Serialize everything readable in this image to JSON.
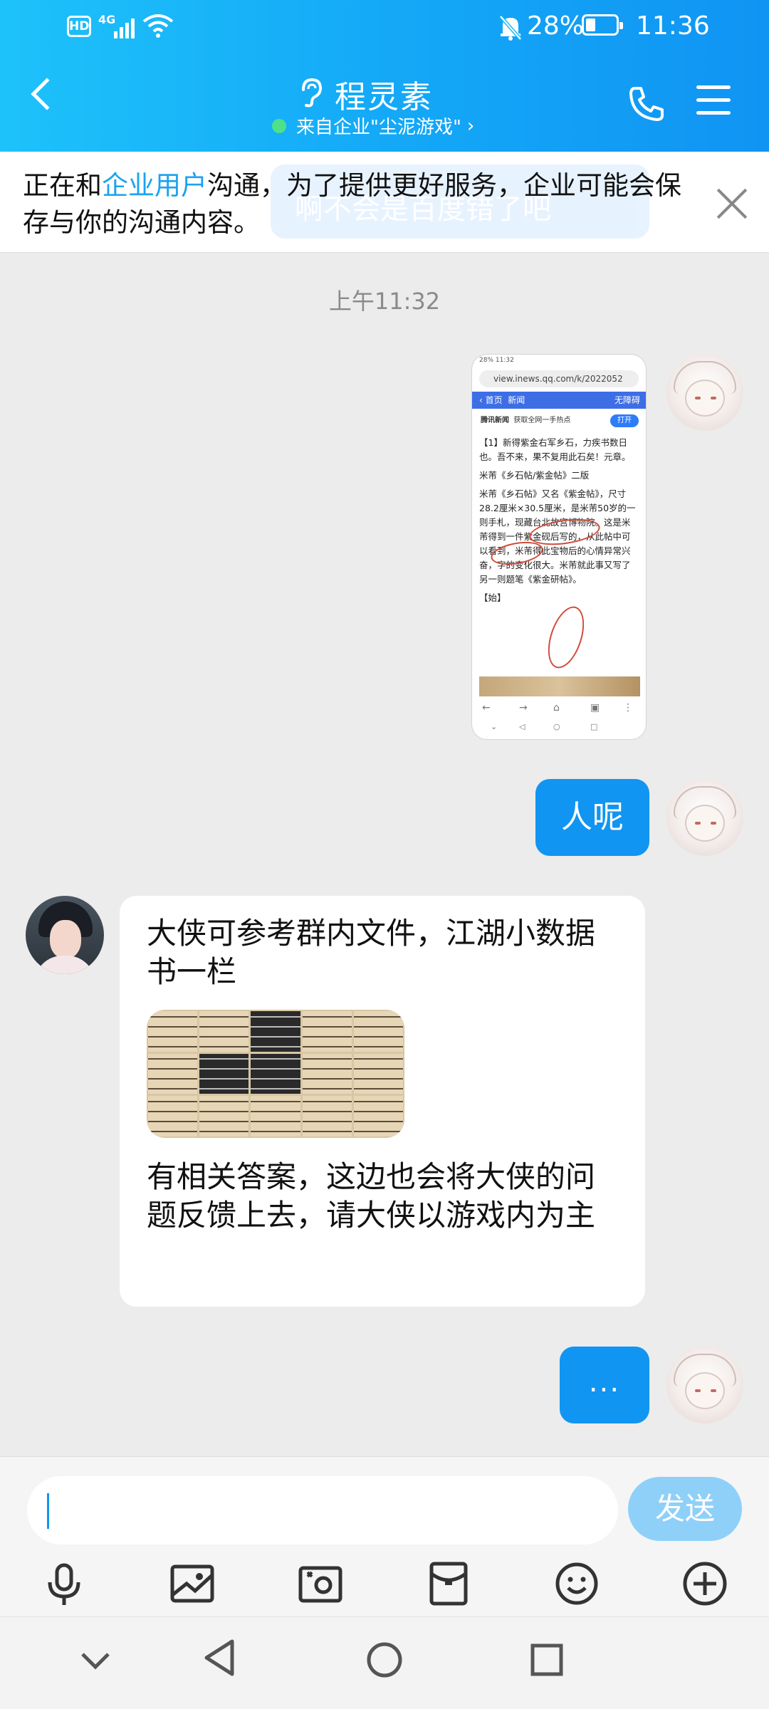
{
  "status_bar": {
    "hd": "HD",
    "network": "4G",
    "battery": "28%",
    "battery_level": 0.28,
    "time": "11:36"
  },
  "header": {
    "title": "程灵素",
    "subtitle": "来自企业\"尘泥游戏\"",
    "chevron": "›"
  },
  "notice": {
    "prefix": "正在和",
    "highlight": "企业用户",
    "suffix": "沟通，为了提供更好服务，企业可能会保存与你的沟通内容。",
    "ghost_message": "啊不会是百度错了吧"
  },
  "chat": {
    "timestamp": "上午11:32",
    "screenshot": {
      "status_battery": "28%",
      "status_time": "11:32",
      "url": "view.inews.qq.com/k/2022052",
      "nav_home": "首页",
      "nav_news": "新闻",
      "nav_mode": "无障碍",
      "brand": "腾讯新闻",
      "brand_slogan": "获取全网一手热点",
      "open_button": "打开",
      "para1": "【1】新得紫金右军乡石，力疾书数日也。吾不来，果不复用此石矣！元章。",
      "para2": "米芾《乡石帖/紫金帖》二版",
      "para3": "米芾《乡石帖》又名《紫金帖》，尺寸28.2厘米×30.5厘米，是米芾50岁的一则手札，现藏台北故宫博物院。这是米芾得到一件紫金砚后写的，从此帖中可以看到，米芾得此宝物后的心情异常兴奋，字的变化很大。米芾就此事又写了另一则题笔《紫金研帖》。",
      "para4": "【始】"
    },
    "msg_me_1": "人呢",
    "agent_text_1": "大侠可参考群内文件，江湖小数据书一栏",
    "agent_text_2": "有相关答案，这边也会将大侠的问题反馈上去，请大侠以游戏内为主",
    "msg_me_2": "..."
  },
  "input_bar": {
    "placeholder": "",
    "send_label": "发送",
    "tools": [
      "voice-icon",
      "image-icon",
      "camera-icon",
      "red-packet-icon",
      "emoji-icon",
      "plus-icon"
    ]
  },
  "system_nav": [
    "collapse-icon",
    "back-icon",
    "home-icon",
    "recents-icon"
  ]
}
